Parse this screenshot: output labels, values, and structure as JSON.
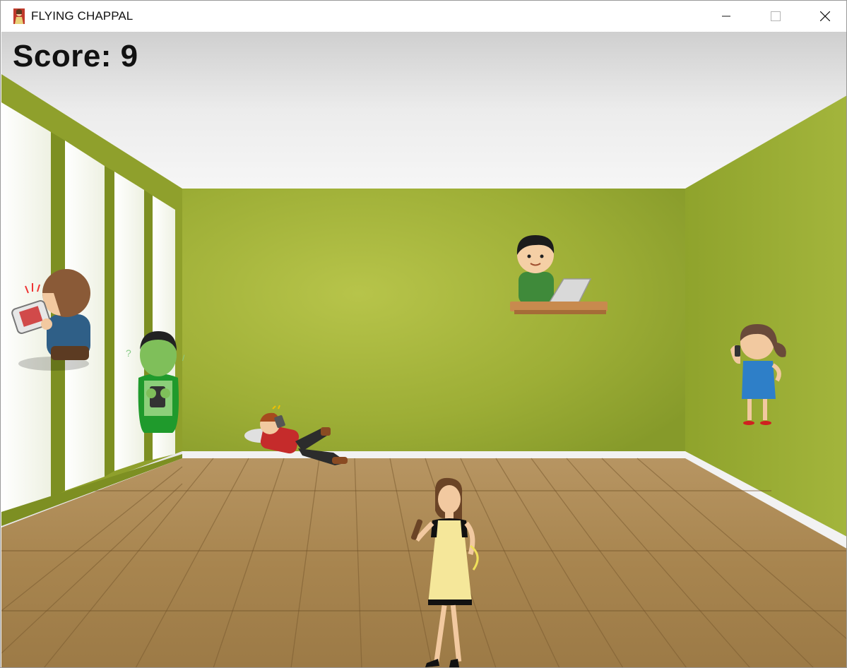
{
  "window": {
    "title": "FLYING CHAPPAL",
    "icon": "chappal-app-icon",
    "controls": [
      "minimize-icon",
      "maximize-icon",
      "close-icon"
    ]
  },
  "hud": {
    "score_label": "Score: 9",
    "score": 9
  },
  "scene": {
    "background": "room-with-green-walls-and-wooden-floor",
    "colors": {
      "wall": "#9fb03a",
      "floor": "#b08a52",
      "ceiling": "#e6e6e6"
    }
  },
  "characters": [
    {
      "name": "boy-playing-handheld-game",
      "role": "target"
    },
    {
      "name": "sick-boy-holding-phone",
      "role": "target"
    },
    {
      "name": "boy-lying-on-floor-with-phone",
      "role": "target"
    },
    {
      "name": "man-with-laptop",
      "role": "target"
    },
    {
      "name": "woman-talking-on-phone",
      "role": "target"
    },
    {
      "name": "mother-player-with-chappal",
      "role": "player"
    }
  ]
}
